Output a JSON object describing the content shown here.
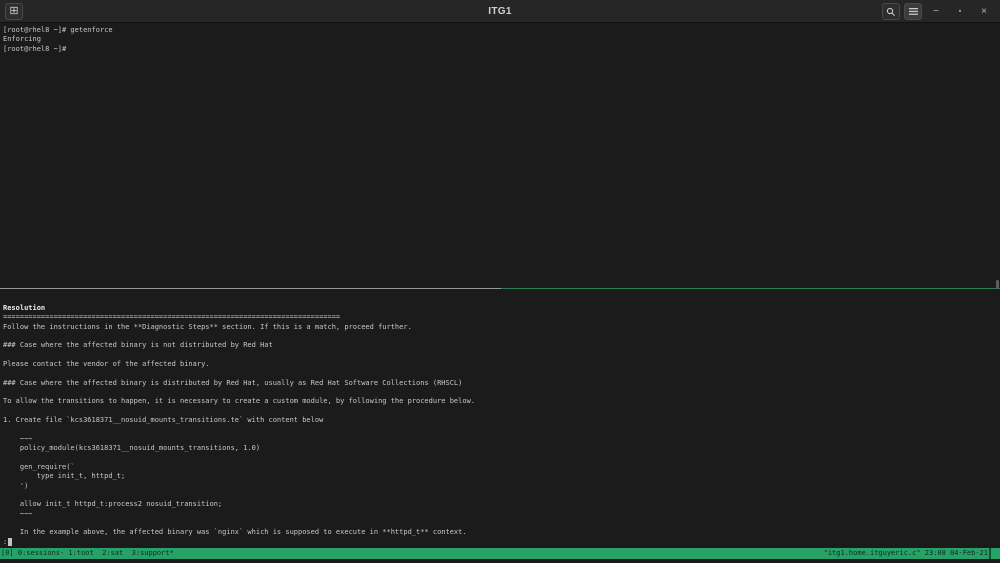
{
  "window": {
    "title": "ITG1",
    "controls": {
      "new_terminal_icon": "⊞",
      "minimize_glyph": "−",
      "maximize_glyph": "▪",
      "close_glyph": "×"
    }
  },
  "colors": {
    "status_green": "#26a269",
    "divider_green": "#2e7e55",
    "divider_gray": "#989898",
    "terminal_bg": "#1b1b1b",
    "terminal_fg": "#c9c8c4"
  },
  "terminal": {
    "pane1": {
      "lines": [
        "[root@rhel8 ~]# getenforce",
        "Enforcing",
        "[root@rhel8 ~]#"
      ]
    },
    "pane2": {
      "heading": "Resolution",
      "lines": [
        "================================================================================",
        "Follow the instructions in the **Diagnostic Steps** section. If this is a match, proceed further.",
        "",
        "### Case where the affected binary is not distributed by Red Hat",
        "",
        "Please contact the vendor of the affected binary.",
        "",
        "### Case where the affected binary is distributed by Red Hat, usually as Red Hat Software Collections (RHSCL)",
        "",
        "To allow the transitions to happen, it is necessary to create a custom module, by following the procedure below.",
        "",
        "1. Create file `kcs3618371__nosuid_mounts_transitions.te` with content below",
        "",
        "    ~~~",
        "    policy_module(kcs3618371__nosuid_mounts_transitions, 1.0)",
        "",
        "    gen_require(`",
        "        type init_t, httpd_t;",
        "    ')",
        "",
        "    allow init_t httpd_t:process2 nosuid_transition;",
        "    ~~~",
        "",
        "    In the example above, the affected binary was `nginx` which is supposed to execute in **httpd_t** context."
      ],
      "pager_prompt": ":"
    }
  },
  "status_bar": {
    "left": "[0] 0:sessions- 1:toot  2:sat  3:support*",
    "right": "\"itg1.home.itguyeric.c\" 23:08 04-Feb-21"
  }
}
